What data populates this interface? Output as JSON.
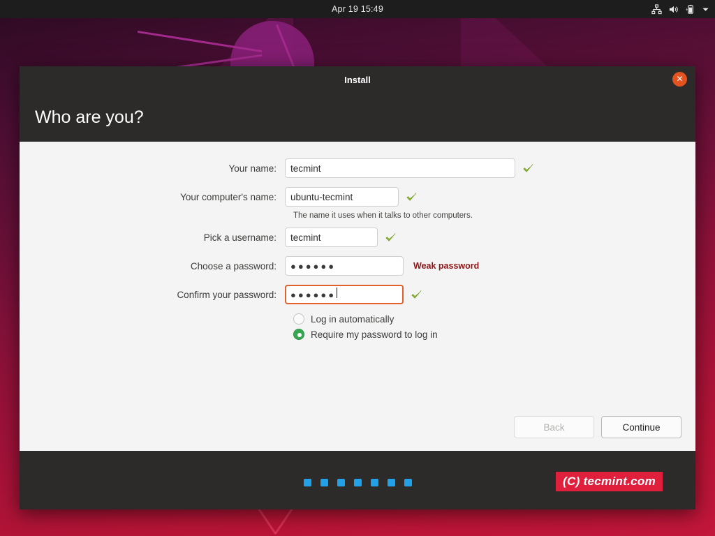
{
  "topbar": {
    "clock": "Apr 19  15:49",
    "icons": [
      "network-icon",
      "volume-icon",
      "battery-icon",
      "chevron-down-icon"
    ]
  },
  "window": {
    "title": "Install",
    "close_label": "✕",
    "heading": "Who are you?"
  },
  "form": {
    "fields": [
      {
        "label": "Your name:",
        "value": "tecmint",
        "status": "valid"
      },
      {
        "label": "Your computer's name:",
        "value": "ubuntu-tecmint",
        "status": "valid"
      },
      {
        "label": "Pick a username:",
        "value": "tecmint",
        "status": "valid"
      },
      {
        "label": "Choose a password:",
        "value": "●●●●●●",
        "status": "weak"
      },
      {
        "label": "Confirm your password:",
        "value": "●●●●●●",
        "status": "valid"
      }
    ],
    "hostname_hint": "The name it uses when it talks to other computers.",
    "password_strength": "Weak password",
    "radio_options": [
      {
        "label": "Log in automatically",
        "selected": false
      },
      {
        "label": "Require my password to log in",
        "selected": true
      }
    ]
  },
  "buttons": {
    "back": "Back",
    "continue": "Continue"
  },
  "footer": {
    "progress_dots": 7,
    "watermark": "(C) tecmint.com"
  },
  "colors": {
    "accent_orange": "#e4521f",
    "focus_border": "#e2602b",
    "valid_green": "#8bb830",
    "radio_green": "#36a852",
    "weak_red": "#8e1616",
    "dot_blue": "#21a2e8",
    "watermark_red": "#e01f3d",
    "window_dark": "#2d2b2a",
    "window_light": "#f4f4f4"
  }
}
